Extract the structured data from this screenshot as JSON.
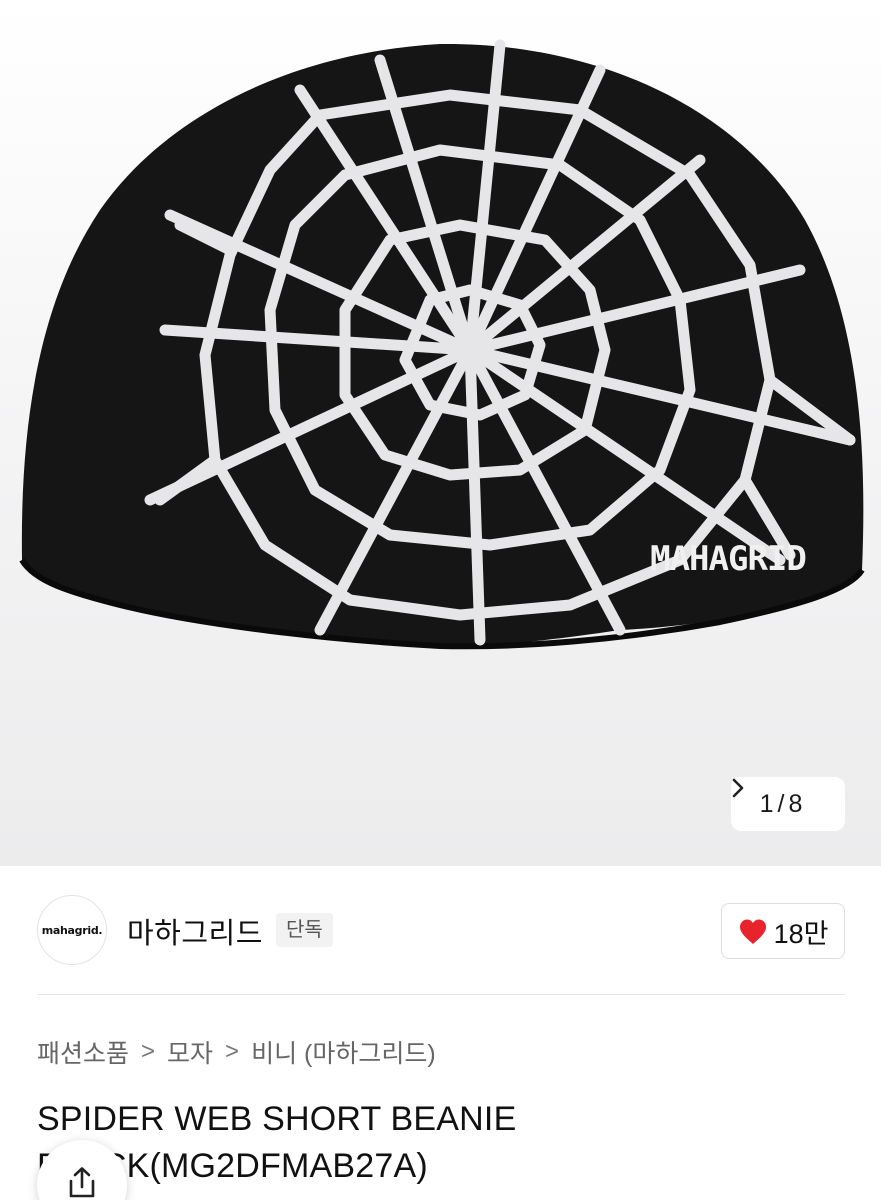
{
  "gallery": {
    "current": "1",
    "separator": "/",
    "total": "8",
    "next_icon": "chevron-right-icon",
    "image_logo_text": "MAHAGRID"
  },
  "brand": {
    "logo_text": "mahagrid.",
    "name": "마하그리드",
    "badge": "단독"
  },
  "like": {
    "icon": "heart-icon",
    "icon_color": "#e8232b",
    "count": "18만"
  },
  "breadcrumb": {
    "items": [
      "패션소품",
      "모자",
      "비니 (마하그리드)"
    ],
    "separator": ">"
  },
  "product": {
    "title": "SPIDER WEB SHORT BEANIE BLACK(MG2DFMAB27A)"
  },
  "share": {
    "icon": "share-icon"
  }
}
